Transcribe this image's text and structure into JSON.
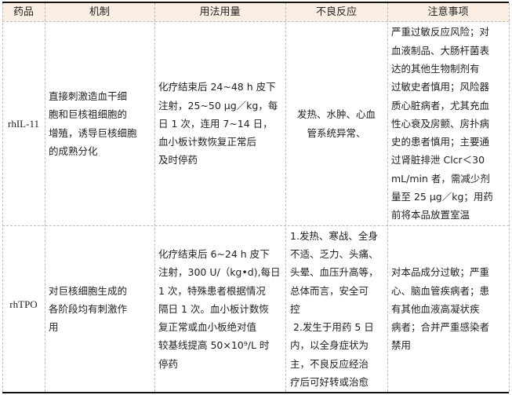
{
  "headers": [
    "药品",
    "机制",
    "用法用量",
    "不良反应",
    "注意事项"
  ],
  "rows": [
    {
      "drug": "rhIL-11",
      "mechanism": [
        "直接刺激造血干细",
        "胞和巨核祖细胞的",
        "增殖，诱导巨核细胞",
        "的成熟分化"
      ],
      "dosage": [
        "化疗结束后 24~48 h 皮下",
        "注射，25~50 μg／kg，每",
        "日 1 次，连用 7~14 日，",
        "血小板计数恢复正常后",
        "及时停药"
      ],
      "adverse": [
        "发热、水肿、心血",
        "管系统异常、"
      ],
      "precautions": [
        "严重过敏反应风险；对",
        "血液制品、大肠杆菌表",
        "达的其他生物制剂有",
        "过敏史者慎用；风险器",
        "质心脏病者，尤其充血",
        "性心衰及房颤、房扑病",
        "史的患者慎用；主要通",
        "过肾脏排泄 Clcr＜30",
        "mL/min 者，需减少剂",
        "量至 25 μg／kg；用药",
        "前将本品放置室温"
      ]
    },
    {
      "drug": "rhTPO",
      "mechanism": [
        "对巨核细胞生成的",
        "各阶段均有刺激作",
        "用"
      ],
      "dosage": [
        "化疗结束后 6~24 h 皮下",
        "注射，300 U/（kg•d),每日",
        "1 次，特殊患者根据情况",
        "隔日 1 次。血小板计数恢",
        "复正常或血小板绝对值",
        "较基线提高 50×10⁹/L 时",
        "停药"
      ],
      "adverse": [
        "1.发热、寒战、全身",
        "不适、乏力、头痛、",
        "头晕、血压升高等，",
        "总体而言，安全可",
        "控",
        " 2.发生于用药 5 日",
        "内，以全身症状为",
        "主，不良反应经治",
        "疗后可好转或治愈"
      ],
      "precautions": [
        "对本品成分过敏；严重",
        "心、脑血管疾病者；患",
        "有其他血液高凝状疾",
        "病者；合并严重感染者",
        "禁用"
      ]
    }
  ]
}
